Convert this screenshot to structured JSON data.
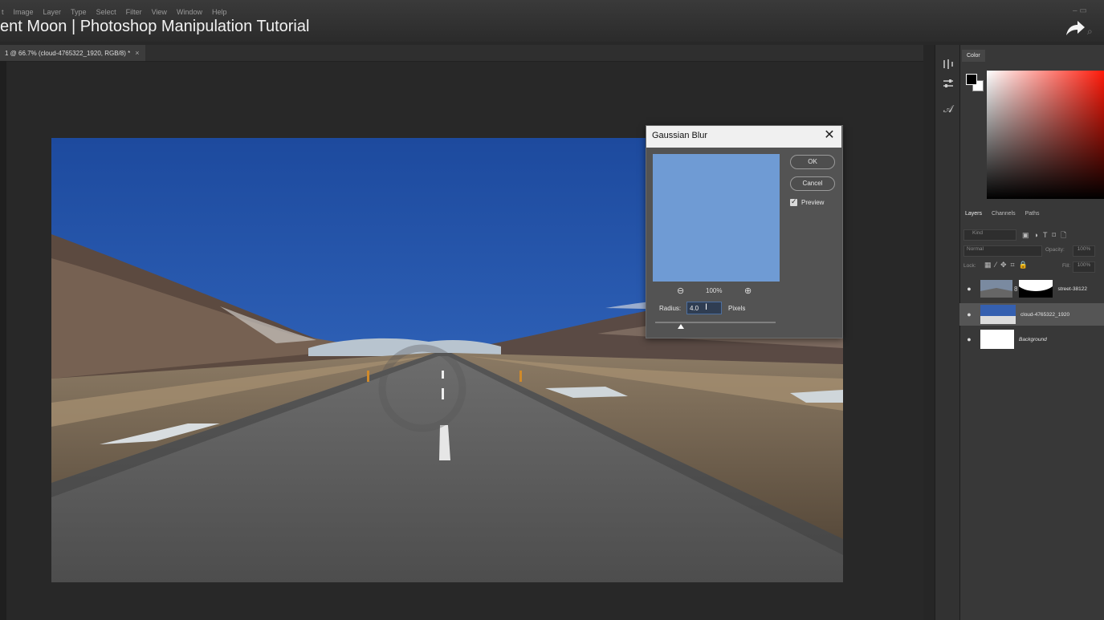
{
  "menu": [
    "t",
    "Image",
    "Layer",
    "Type",
    "Select",
    "Filter",
    "View",
    "Window",
    "Help"
  ],
  "video_title": "ent Moon | Photoshop Manipulation Tutorial",
  "doc_tab": {
    "label": "1 @ 66.7% (cloud-4765322_1920, RGB/8) *",
    "close": "×"
  },
  "window_controls": "– ▭",
  "search_symbol": "⌕",
  "icons": {
    "share": "share-arrow-icon",
    "close": "close-icon",
    "eye": "eye-icon",
    "zoom_out": "zoom-out-icon",
    "zoom_in": "zoom-in-icon"
  },
  "tool_panel": {
    "icon3": "𝒜"
  },
  "color_panel": {
    "tab": "Color",
    "fg": "#000000",
    "bg": "#ffffff"
  },
  "layers_panel": {
    "tabs": [
      "Layers",
      "Channels",
      "Paths"
    ],
    "kind_placeholder": "Kind",
    "blend_mode": "Normal",
    "opacity_label": "Opacity:",
    "opacity_value": "100%",
    "lock_label": "Lock:",
    "fill_label": "Fill:",
    "fill_value": "100%",
    "layers": [
      {
        "name": "street-38122",
        "visible": true,
        "italic": false,
        "selected": false
      },
      {
        "name": "cloud-4765322_1920",
        "visible": true,
        "italic": false,
        "selected": true
      },
      {
        "name": "Background",
        "visible": true,
        "italic": true,
        "selected": false
      }
    ]
  },
  "dialog": {
    "title": "Gaussian Blur",
    "close": "✕",
    "ok": "OK",
    "cancel": "Cancel",
    "preview_label": "Preview",
    "preview_checked": true,
    "zoom_out_symbol": "⊖",
    "zoom_in_symbol": "⊕",
    "zoom": "100%",
    "radius_label": "Radius:",
    "radius_value": "4.0",
    "radius_unit": "Pixels",
    "preview_color": "#6f9bd4"
  }
}
